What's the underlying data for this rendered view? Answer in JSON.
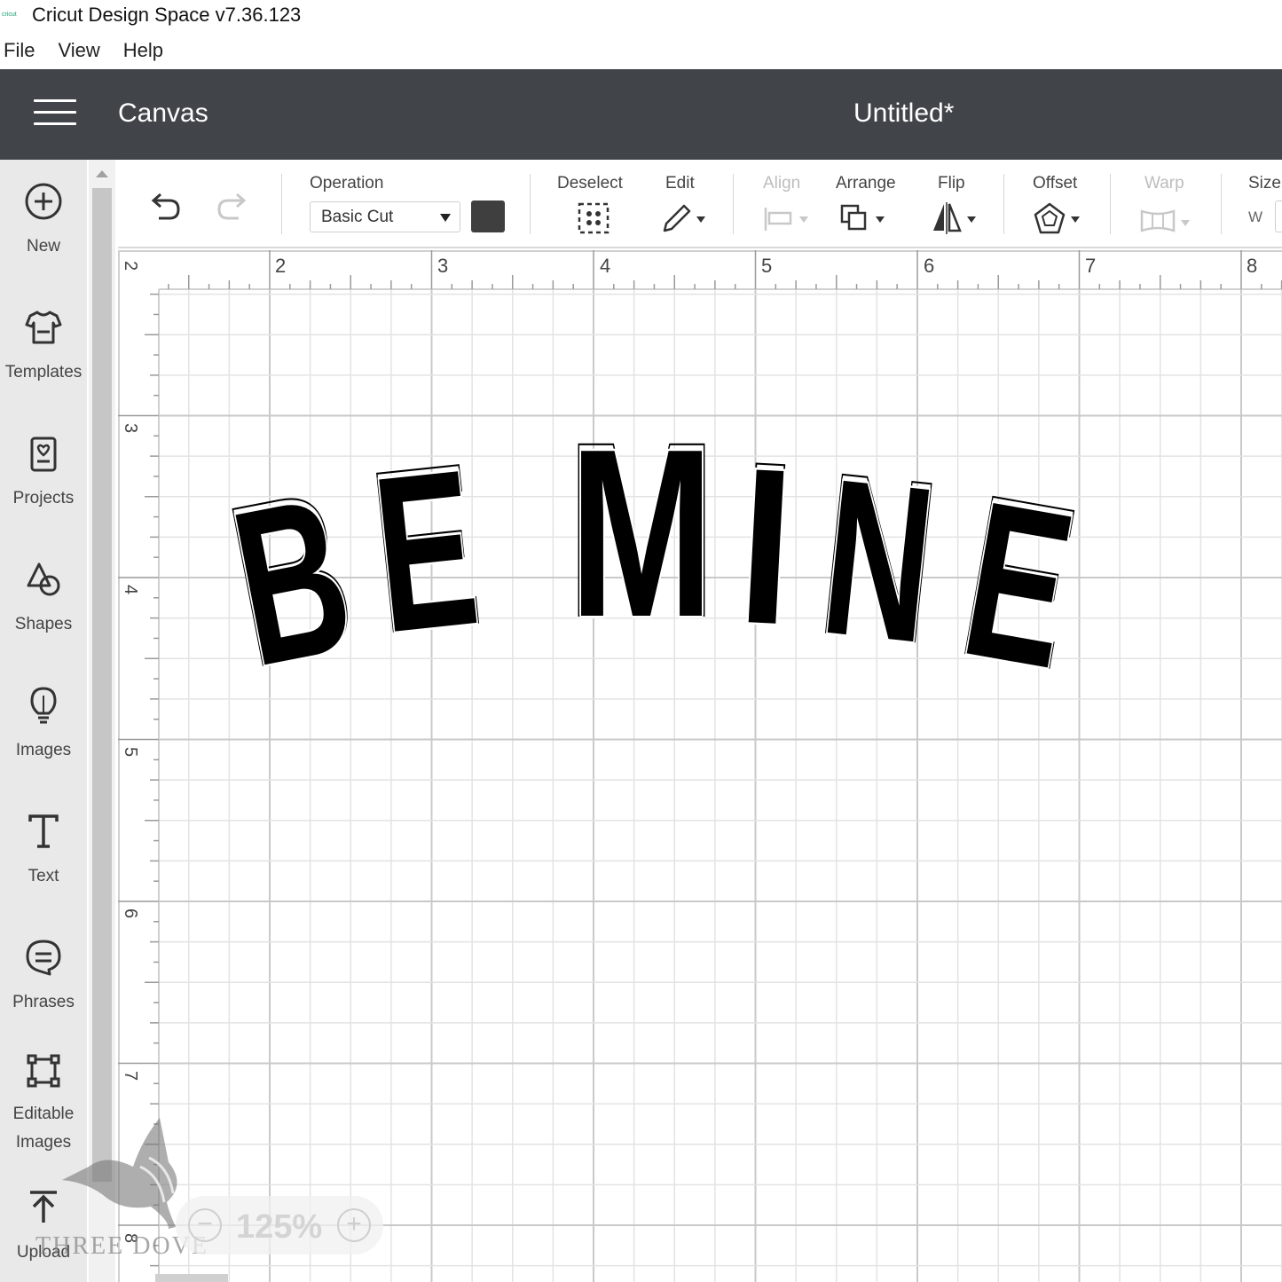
{
  "window": {
    "title": "Cricut Design Space  v7.36.123",
    "app_icon_text": "cricut"
  },
  "menu": {
    "items": [
      "File",
      "View",
      "Help"
    ]
  },
  "header": {
    "section": "Canvas",
    "document_title": "Untitled*",
    "bg_color": "#414549"
  },
  "sidebar": {
    "items": [
      {
        "label": "New",
        "icon": "plus-circle-icon"
      },
      {
        "label": "Templates",
        "icon": "tshirt-icon"
      },
      {
        "label": "Projects",
        "icon": "project-icon"
      },
      {
        "label": "Shapes",
        "icon": "shapes-icon"
      },
      {
        "label": "Images",
        "icon": "lightbulb-icon"
      },
      {
        "label": "Text",
        "icon": "text-icon"
      },
      {
        "label": "Phrases",
        "icon": "speech-bubble-icon"
      },
      {
        "label": "Editable\nImages",
        "icon": "editable-images-icon"
      },
      {
        "label": "Upload",
        "icon": "upload-icon"
      }
    ]
  },
  "toolbar": {
    "operation_label": "Operation",
    "operation_value": "Basic Cut",
    "swatch_color": "#3f3f3f",
    "deselect_label": "Deselect",
    "edit_label": "Edit",
    "align_label": "Align",
    "arrange_label": "Arrange",
    "flip_label": "Flip",
    "offset_label": "Offset",
    "warp_label": "Warp",
    "size_label": "Size",
    "size_w_label": "W"
  },
  "canvas": {
    "ruler_top": [
      "2",
      "3",
      "4",
      "5",
      "6",
      "7",
      "8"
    ],
    "ruler_left": [
      "2",
      "3",
      "4",
      "5",
      "6",
      "7",
      "8"
    ],
    "design_text": "BE MINE",
    "design_color": "#000000"
  },
  "zoom": {
    "minus": "−",
    "value": "125%",
    "plus": "+"
  },
  "watermark": {
    "text": "THREE DOVE"
  }
}
